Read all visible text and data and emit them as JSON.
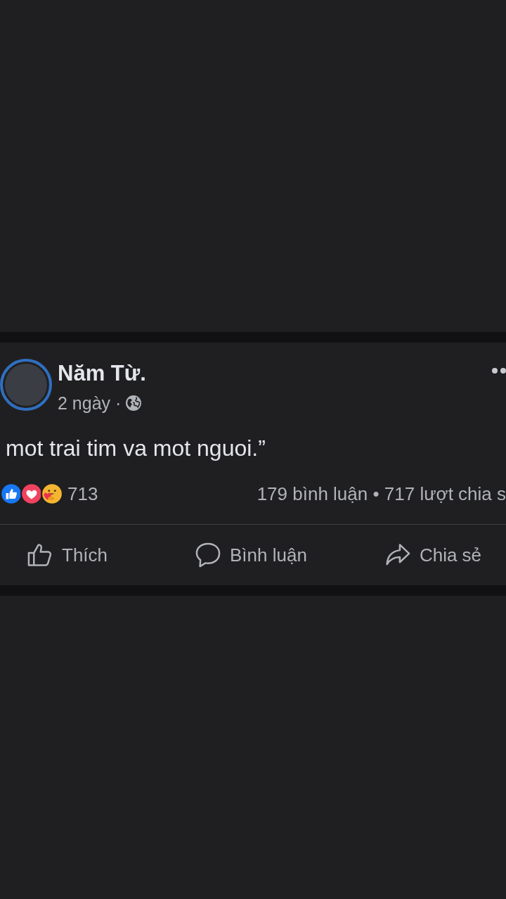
{
  "post": {
    "author": "Năm Từ.",
    "time": "2 ngày ·",
    "text": "mot trai tim va mot nguoi.”"
  },
  "stats": {
    "reaction_count": "713",
    "summary": "179 bình luận • 717 lượt chia s"
  },
  "actions": [
    {
      "kind": "like",
      "label": "Thích"
    },
    {
      "kind": "comment",
      "label": "Bình luận"
    },
    {
      "kind": "share",
      "label": "Chia sẻ"
    }
  ]
}
